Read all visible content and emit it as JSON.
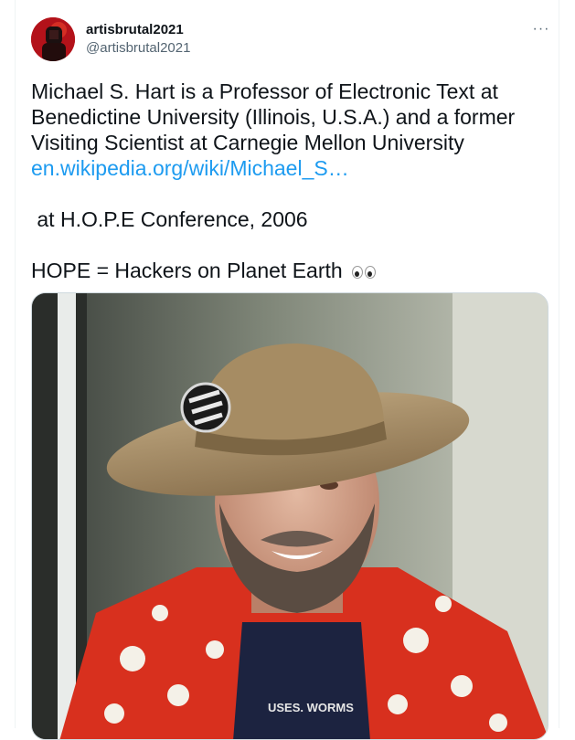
{
  "tweet": {
    "display_name": "artisbrutal2021",
    "handle": "@artisbrutal2021",
    "more_glyph": "···",
    "text_line1": "Michael S. Hart is a Professor of Electronic Text at Benedictine University (Illinois, U.S.A.) and a former Visiting Scientist at Carnegie Mellon University",
    "link": "en.wikipedia.org/wiki/Michael_S…",
    "text_line2": "at H.O.P.E Conference, 2006",
    "text_line3": "HOPE = Hackers on Planet Earth",
    "emoji_name": "eyes-emoji",
    "shirt_text": "USES. WORMS"
  },
  "colors": {
    "link": "#1d9bf0",
    "text": "#0f1419",
    "muted": "#536471",
    "shirt_red": "#d8301e"
  }
}
